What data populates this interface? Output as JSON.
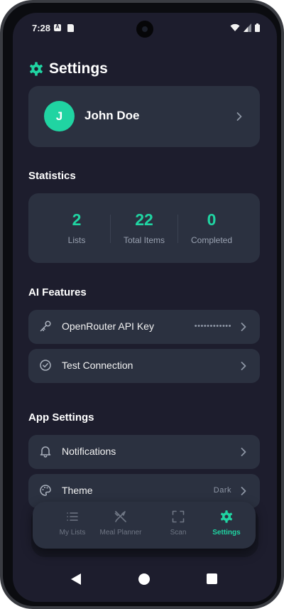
{
  "status_bar": {
    "time": "7:28"
  },
  "header": {
    "title": "Settings"
  },
  "profile": {
    "initial": "J",
    "name": "John Doe"
  },
  "statistics": {
    "title": "Statistics",
    "items": [
      {
        "value": "2",
        "label": "Lists"
      },
      {
        "value": "22",
        "label": "Total Items"
      },
      {
        "value": "0",
        "label": "Completed"
      }
    ]
  },
  "ai_features": {
    "title": "AI Features",
    "api_key": {
      "label": "OpenRouter API Key",
      "value": "••••••••••••"
    },
    "test_connection": {
      "label": "Test Connection"
    }
  },
  "app_settings": {
    "title": "App Settings",
    "notifications": {
      "label": "Notifications"
    },
    "theme": {
      "label": "Theme",
      "value": "Dark"
    }
  },
  "bottom_nav": {
    "items": [
      {
        "label": "My Lists",
        "icon": "list-icon"
      },
      {
        "label": "Meal Planner",
        "icon": "utensils-icon"
      },
      {
        "label": "Scan",
        "icon": "scan-icon"
      },
      {
        "label": "Settings",
        "icon": "gear-icon",
        "active": true
      }
    ]
  },
  "colors": {
    "accent": "#20d4a2",
    "background": "#1d1d2d",
    "card": "#2b3140"
  }
}
